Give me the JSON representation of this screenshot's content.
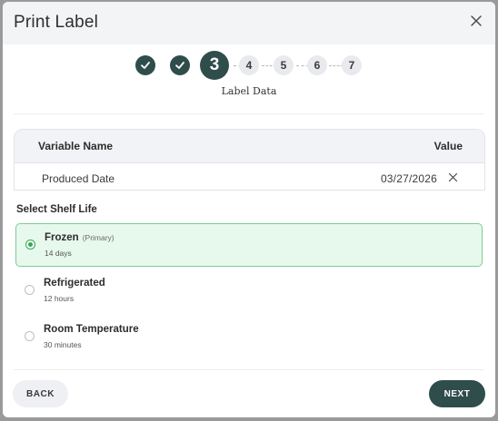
{
  "dialog": {
    "title": "Print Label",
    "close_icon": "close-icon"
  },
  "stepper": {
    "current_step": 3,
    "total_steps": 7,
    "steps": [
      {
        "number": "1",
        "state": "done",
        "icon": "check-icon"
      },
      {
        "number": "2",
        "state": "done",
        "icon": "check-icon"
      },
      {
        "number": "3",
        "state": "current"
      },
      {
        "number": "4",
        "state": "future"
      },
      {
        "number": "5",
        "state": "future"
      },
      {
        "number": "6",
        "state": "future"
      },
      {
        "number": "7",
        "state": "future"
      }
    ],
    "caption": "Label Data"
  },
  "variables": {
    "headers": {
      "name": "Variable Name",
      "value": "Value"
    },
    "rows": [
      {
        "name": "Produced Date",
        "value": "03/27/2026",
        "clear_icon": "close-icon"
      }
    ]
  },
  "shelf_life": {
    "label": "Select Shelf Life",
    "selected": "Frozen",
    "options": [
      {
        "title": "Frozen",
        "tag": "(Primary)",
        "duration": "14 days",
        "selected": true
      },
      {
        "title": "Refrigerated",
        "tag": "",
        "duration": "12 hours",
        "selected": false
      },
      {
        "title": "Room Temperature",
        "tag": "",
        "duration": "30 minutes",
        "selected": false
      }
    ]
  },
  "footer": {
    "back_label": "BACK",
    "next_label": "NEXT"
  },
  "colors": {
    "accent": "#2f4d4a",
    "selected_bg": "#e7f8ec",
    "selected_border": "#7fcc95",
    "radio_selected": "#32a852"
  }
}
